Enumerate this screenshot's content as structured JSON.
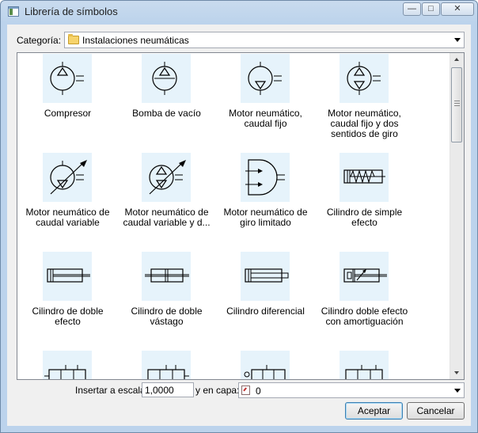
{
  "window": {
    "title": "Librería de símbolos",
    "min_glyph": "—",
    "max_glyph": "□",
    "close_glyph": "✕"
  },
  "category": {
    "label": "Categoría:",
    "value": "Instalaciones neumáticas"
  },
  "symbols": [
    {
      "label": "Compresor",
      "icon": "compressor-icon"
    },
    {
      "label": "Bomba de vacío",
      "icon": "vacuum-pump-icon"
    },
    {
      "label": "Motor neumático, caudal fijo",
      "icon": "motor-fixed-icon"
    },
    {
      "label": "Motor neumático, caudal fijo y dos sentidos de giro",
      "icon": "motor-fixed-bidirectional-icon"
    },
    {
      "label": "Motor neumático de caudal variable",
      "icon": "motor-variable-icon"
    },
    {
      "label": "Motor neumático de caudal variable y d...",
      "icon": "motor-variable-bidirectional-icon"
    },
    {
      "label": "Motor neumático de giro limitado",
      "icon": "limited-rotation-motor-icon"
    },
    {
      "label": "Cilindro de simple efecto",
      "icon": "single-acting-cylinder-icon"
    },
    {
      "label": "Cilindro de doble efecto",
      "icon": "double-acting-cylinder-icon"
    },
    {
      "label": "Cilindro de doble vástago",
      "icon": "double-rod-cylinder-icon"
    },
    {
      "label": "Cilindro diferencial",
      "icon": "differential-cylinder-icon"
    },
    {
      "label": "Cilindro doble efecto con amortiguación",
      "icon": "cushioned-cylinder-icon"
    },
    {
      "label": "",
      "icon": "valve-icon"
    },
    {
      "label": "",
      "icon": "valve-icon"
    },
    {
      "label": "",
      "icon": "valve-icon"
    },
    {
      "label": "",
      "icon": "valve-icon"
    }
  ],
  "scale": {
    "label": "Insertar a escala:",
    "value": "1,0000"
  },
  "layer": {
    "label": "y en capa:",
    "value": "0"
  },
  "buttons": {
    "ok": "Aceptar",
    "cancel": "Cancelar"
  }
}
